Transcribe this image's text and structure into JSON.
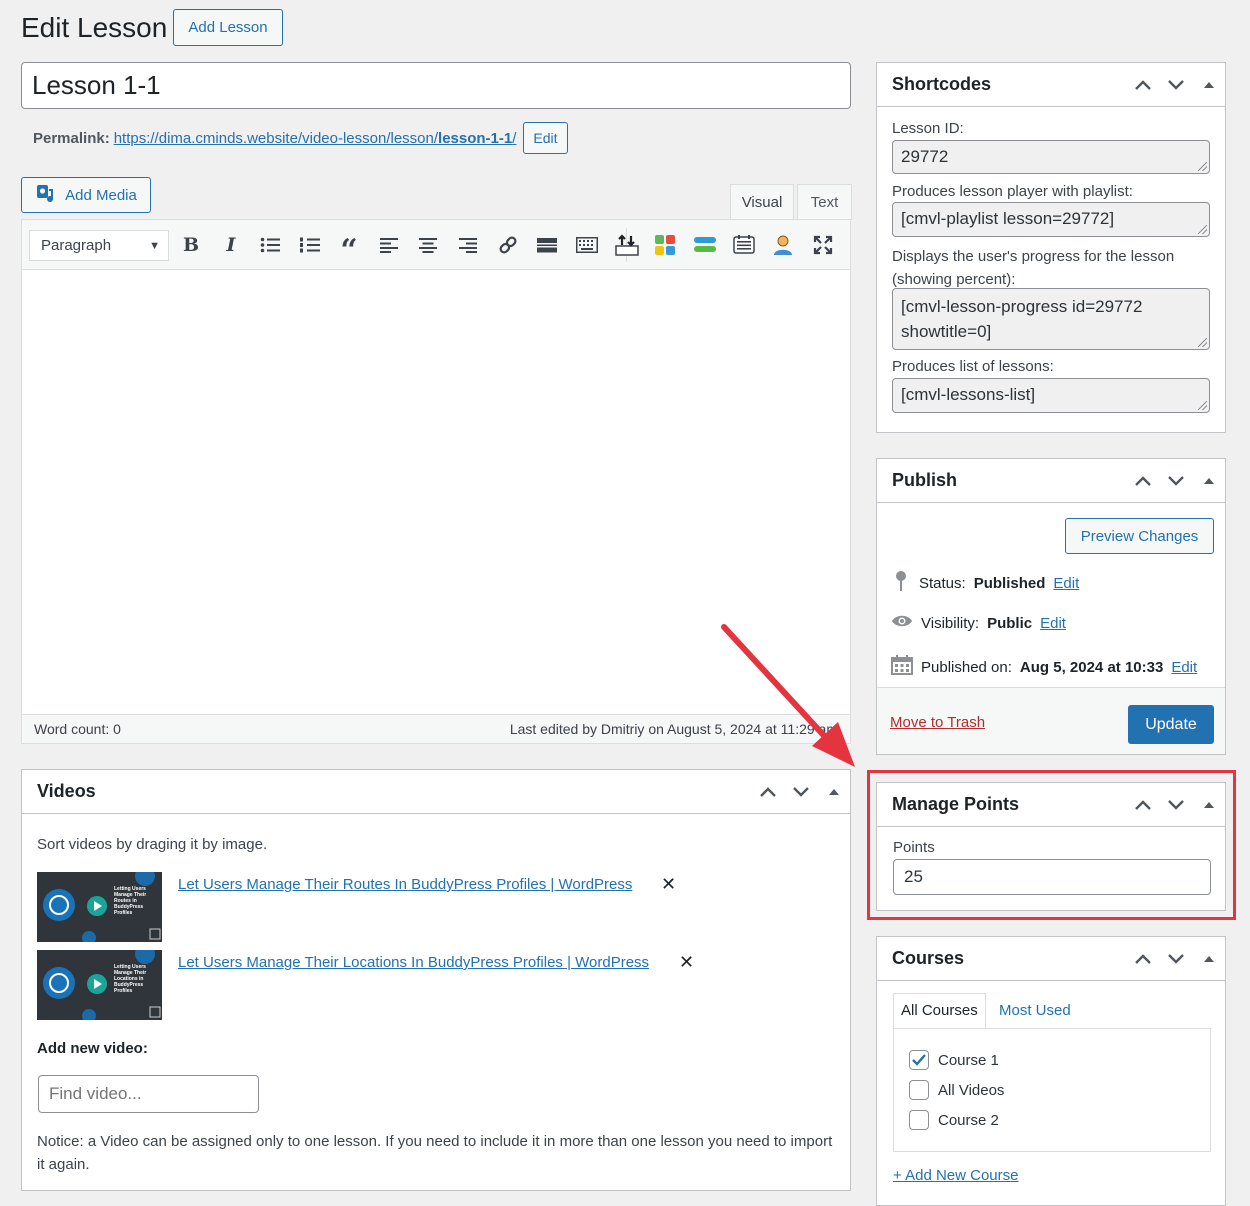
{
  "header": {
    "title": "Edit Lesson",
    "add_button": "Add Lesson"
  },
  "post": {
    "title_value": "Lesson 1-1",
    "permalink_label": "Permalink:",
    "permalink_base": "https://dima.cminds.website/video-lesson/lesson/",
    "permalink_slug": "lesson-1-1",
    "permalink_tail": "/",
    "permalink_edit": "Edit"
  },
  "editor": {
    "add_media": "Add Media",
    "tab_visual": "Visual",
    "tab_text": "Text",
    "format_select": "Paragraph",
    "word_count": "Word count: 0",
    "last_edited": "Last edited by Dmitriy on August 5, 2024 at 11:29 am"
  },
  "videos": {
    "title": "Videos",
    "hint": "Sort videos by draging it by image.",
    "items": [
      {
        "title": "Let Users Manage Their Routes In BuddyPress Profiles | WordPress",
        "thumb_caption": "Letting Users Manage Their Routes in BuddyPress Profiles"
      },
      {
        "title": "Let Users Manage Their Locations In BuddyPress Profiles | WordPress",
        "thumb_caption": "Letting Users Manage Their Locations in BuddyPress Profiles"
      }
    ],
    "add_label": "Add new video:",
    "find_placeholder": "Find video...",
    "notice": "Notice: a Video can be assigned only to one lesson. If you need to include it in more than one lesson you need to import it again."
  },
  "shortcodes": {
    "title": "Shortcodes",
    "fields": [
      {
        "label": "Lesson ID:",
        "value": "29772"
      },
      {
        "label": "Produces lesson player with playlist:",
        "value": "[cmvl-playlist lesson=29772]"
      },
      {
        "label": "Displays the user's progress for the lesson (showing percent):",
        "value": "[cmvl-lesson-progress id=29772 showtitle=0]"
      },
      {
        "label": "Produces list of lessons:",
        "value": "[cmvl-lessons-list]"
      }
    ]
  },
  "publish": {
    "title": "Publish",
    "preview": "Preview Changes",
    "status_label": "Status:",
    "status_value": "Published",
    "visibility_label": "Visibility:",
    "visibility_value": "Public",
    "published_label": "Published on:",
    "published_value": "Aug 5, 2024 at 10:33",
    "edit": "Edit",
    "trash": "Move to Trash",
    "update": "Update"
  },
  "points": {
    "title": "Manage Points",
    "label": "Points",
    "value": "25"
  },
  "courses": {
    "title": "Courses",
    "tab_all": "All Courses",
    "tab_used": "Most Used",
    "items": [
      {
        "label": "Course 1",
        "checked": true
      },
      {
        "label": "All Videos",
        "checked": false
      },
      {
        "label": "Course 2",
        "checked": false
      }
    ],
    "add_new": "+ Add New Course"
  },
  "colors": {
    "accent": "#2271b1",
    "highlight": "#e3343f",
    "danger": "#b32d2e"
  }
}
